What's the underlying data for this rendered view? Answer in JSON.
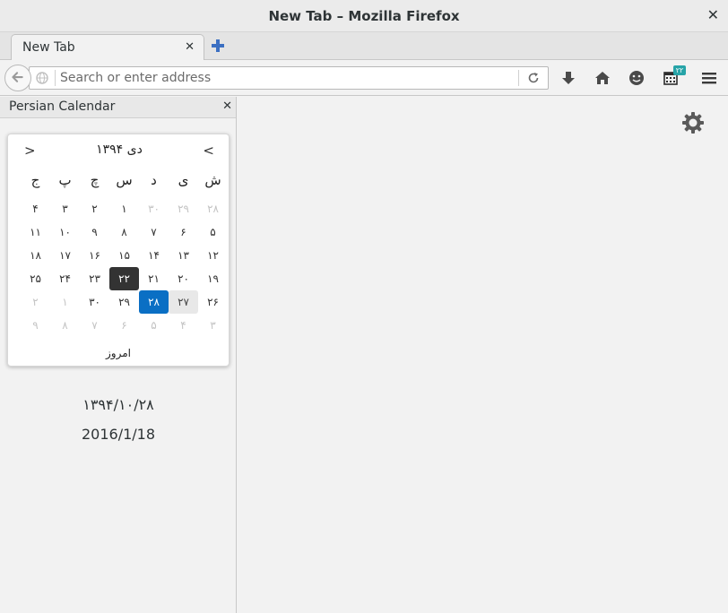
{
  "window": {
    "title": "New Tab – Mozilla Firefox",
    "close_glyph": "✕"
  },
  "tabs": [
    {
      "label": "New Tab",
      "close_glyph": "✕"
    }
  ],
  "navbar": {
    "address_placeholder": "Search or enter address",
    "badge": "۲۲"
  },
  "sidebar": {
    "title": "Persian Calendar",
    "close_glyph": "✕",
    "calendar": {
      "month_label": "دی ۱۳۹۴",
      "prev_glyph": ">",
      "next_glyph": "<",
      "weekdays": [
        "ش",
        "ی",
        "د",
        "س",
        "چ",
        "پ",
        "ج"
      ],
      "weeks": [
        [
          {
            "d": "۲۸",
            "other": true
          },
          {
            "d": "۲۹",
            "other": true
          },
          {
            "d": "۳۰",
            "other": true
          },
          {
            "d": "۱"
          },
          {
            "d": "۲"
          },
          {
            "d": "۳"
          },
          {
            "d": "۴"
          }
        ],
        [
          {
            "d": "۵"
          },
          {
            "d": "۶"
          },
          {
            "d": "۷"
          },
          {
            "d": "۸"
          },
          {
            "d": "۹"
          },
          {
            "d": "۱۰"
          },
          {
            "d": "۱۱"
          }
        ],
        [
          {
            "d": "۱۲"
          },
          {
            "d": "۱۳"
          },
          {
            "d": "۱۴"
          },
          {
            "d": "۱۵"
          },
          {
            "d": "۱۶"
          },
          {
            "d": "۱۷"
          },
          {
            "d": "۱۸"
          }
        ],
        [
          {
            "d": "۱۹"
          },
          {
            "d": "۲۰"
          },
          {
            "d": "۲۱"
          },
          {
            "d": "۲۲",
            "state": "selected"
          },
          {
            "d": "۲۳"
          },
          {
            "d": "۲۴"
          },
          {
            "d": "۲۵"
          }
        ],
        [
          {
            "d": "۲۶"
          },
          {
            "d": "۲۷",
            "state": "hover"
          },
          {
            "d": "۲۸",
            "state": "today"
          },
          {
            "d": "۲۹"
          },
          {
            "d": "۳۰"
          },
          {
            "d": "۱",
            "other": true
          },
          {
            "d": "۲",
            "other": true
          }
        ],
        [
          {
            "d": "۳",
            "other": true
          },
          {
            "d": "۴",
            "other": true
          },
          {
            "d": "۵",
            "other": true
          },
          {
            "d": "۶",
            "other": true
          },
          {
            "d": "۷",
            "other": true
          },
          {
            "d": "۸",
            "other": true
          },
          {
            "d": "۹",
            "other": true
          }
        ]
      ],
      "today_label": "امروز"
    },
    "persian_date": "۱۳۹۴/۱۰/۲۸",
    "gregorian_date": "2016/1/18"
  },
  "colors": {
    "accent": "#0a6fc4",
    "selected": "#333333",
    "badge": "#27a4a8"
  }
}
